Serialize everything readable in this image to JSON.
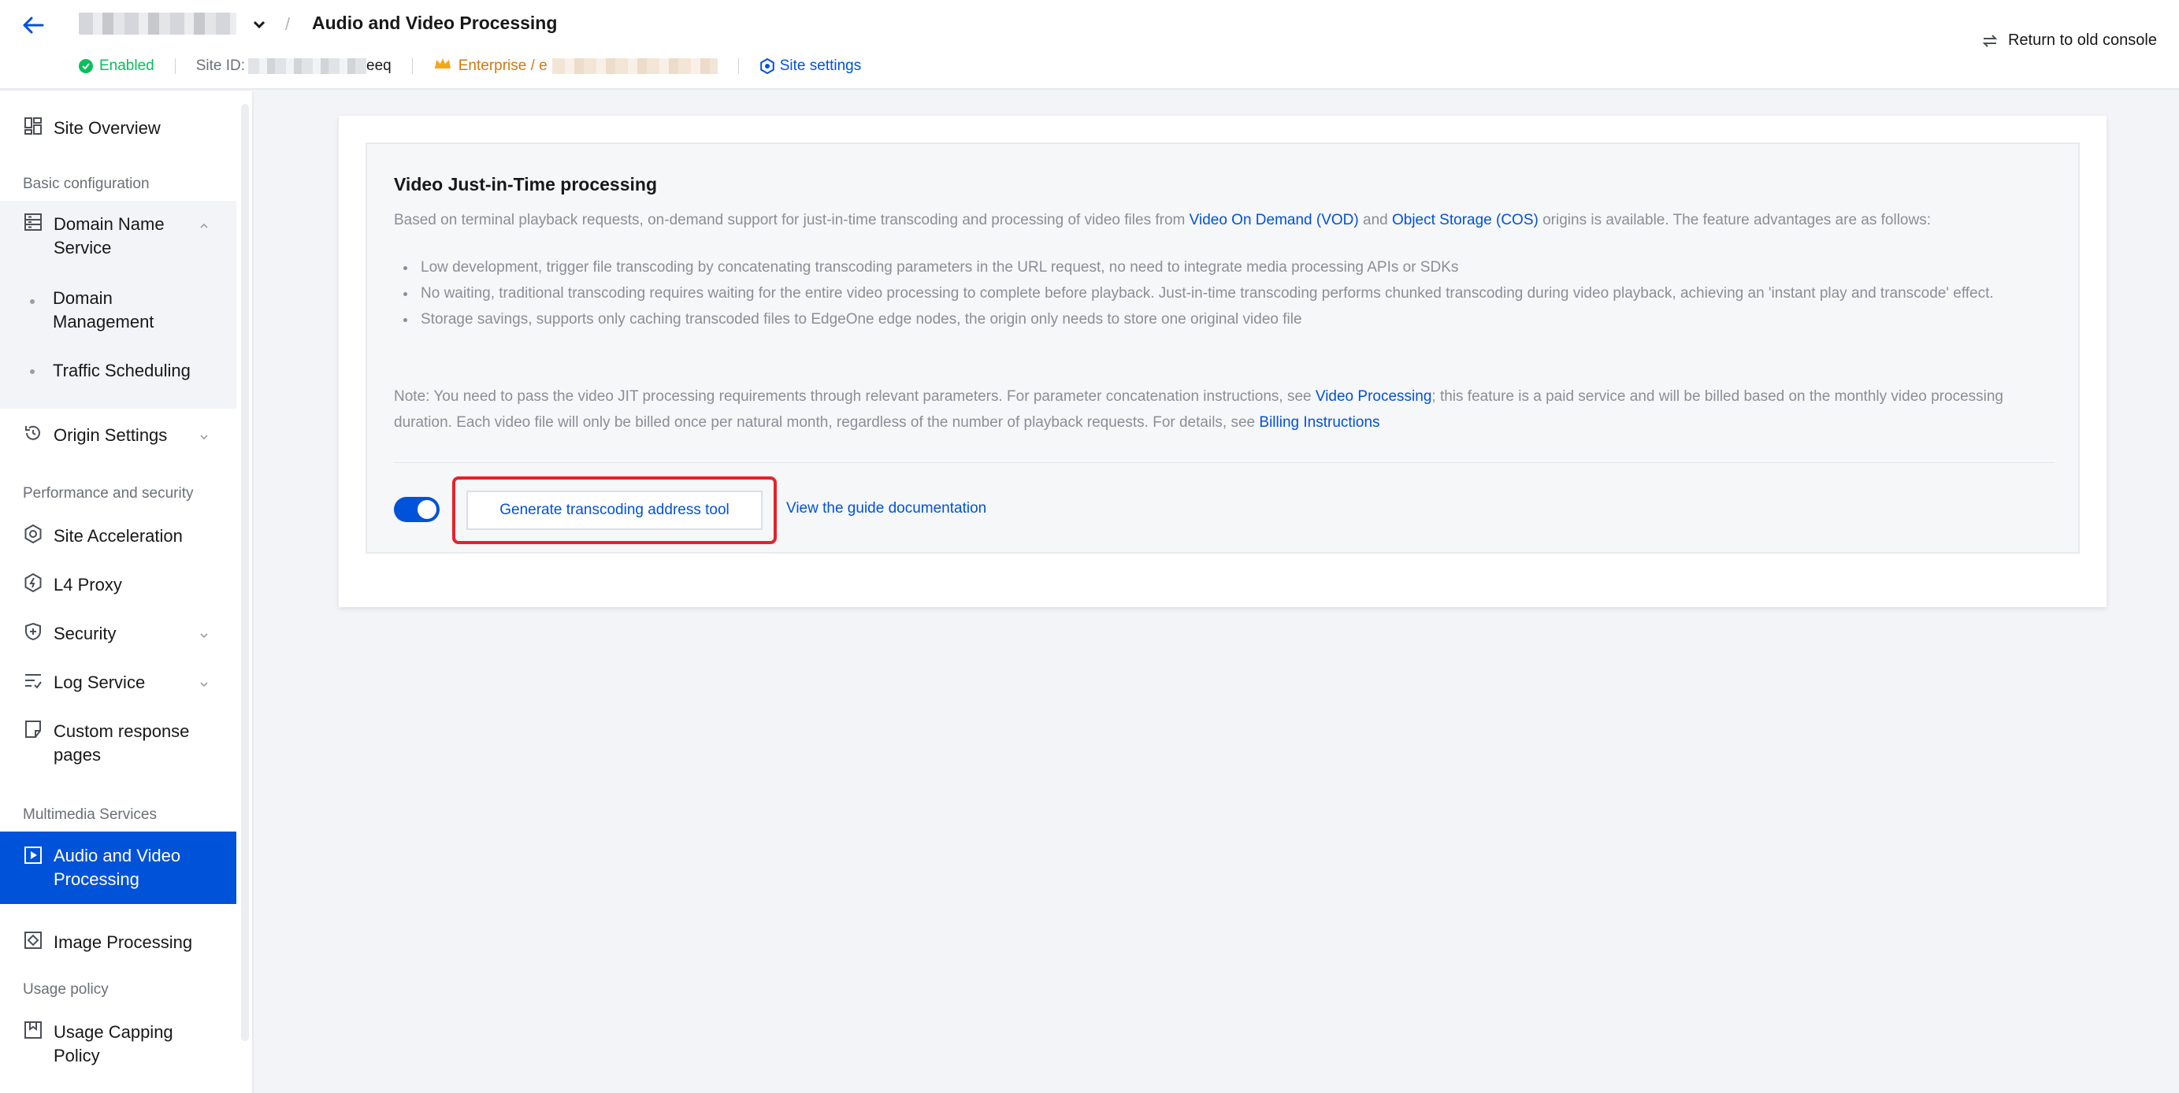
{
  "header": {
    "page_title": "Audio and Video Processing",
    "breadcrumb_separator": "/",
    "status": "Enabled",
    "site_id_label": "Site ID:",
    "site_id_suffix": "eeq",
    "plan_label": "Enterprise / e",
    "site_settings": "Site settings",
    "return_old_console": "Return to old console"
  },
  "sidebar": {
    "overview": "Site Overview",
    "groups": {
      "basic": "Basic configuration",
      "performance": "Performance and security",
      "multimedia": "Multimedia Services",
      "usage": "Usage policy"
    },
    "items": {
      "domain_name_service": "Domain Name Service",
      "domain_management": "Domain Management",
      "traffic_scheduling": "Traffic Scheduling",
      "origin_settings": "Origin Settings",
      "site_acceleration": "Site Acceleration",
      "l4_proxy": "L4 Proxy",
      "security": "Security",
      "log_service": "Log Service",
      "custom_response_pages": "Custom response pages",
      "audio_video_processing": "Audio and Video Processing",
      "image_processing": "Image Processing",
      "usage_capping_policy": "Usage Capping Policy"
    }
  },
  "main": {
    "title": "Video Just-in-Time processing",
    "intro_prefix": "Based on terminal playback requests, on-demand support for just-in-time transcoding and processing of video files from ",
    "link_vod": "Video On Demand (VOD)",
    "intro_and": " and ",
    "link_cos": "Object Storage (COS)",
    "intro_suffix": " origins is available. The feature advantages are as follows:",
    "bullets": [
      "Low development, trigger file transcoding by concatenating transcoding parameters in the URL request, no need to integrate media processing APIs or SDKs",
      "No waiting, traditional transcoding requires waiting for the entire video processing to complete before playback. Just-in-time transcoding performs chunked transcoding during video playback, achieving an 'instant play and transcode' effect.",
      "Storage savings, supports only caching transcoded files to EdgeOne edge nodes, the origin only needs to store one original video file"
    ],
    "note_prefix": "Note: You need to pass the video JIT processing requirements through relevant parameters. For parameter concatenation instructions, see ",
    "link_video_processing": "Video Processing",
    "note_middle": "; this feature is a paid service and will be billed based on the monthly video processing duration. Each video file will only be billed once per natural month, regardless of the number of playback requests. For details, see ",
    "link_billing": "Billing Instructions",
    "toggle_on": true,
    "generate_button": "Generate transcoding address tool",
    "guide_link": "View the guide documentation"
  },
  "colors": {
    "accent": "#0052d9",
    "enabled": "#0abf5b",
    "plan": "#d07a10",
    "highlight": "#e5222a"
  }
}
